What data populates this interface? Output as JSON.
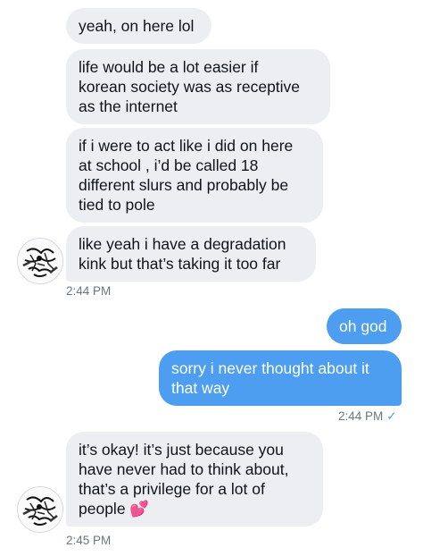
{
  "thread": {
    "incoming_group_1": [
      "yeah, on here lol",
      "life would be a lot easier if\nkorean society was as receptive\nas the internet",
      "if i were to act like i did on here\nat school , i’d be called 18\ndifferent slurs and probably be\ntied to pole",
      "like yeah i have a degradation\nkink but that’s taking it too far"
    ],
    "timestamp_1": "2:44 PM",
    "outgoing": [
      "oh god",
      "sorry i never thought about it\nthat way"
    ],
    "timestamp_2": "2:44 PM",
    "read_check": "✓",
    "incoming_group_2": [
      "it’s okay! it’s just because you\nhave never had to think about,\nthat’s a privilege for a lot of\npeople 💕"
    ],
    "timestamp_3": "2:45 PM"
  },
  "colors": {
    "incoming_bubble": "#eceef2",
    "outgoing_bubble": "#4d9ef0",
    "timestamp": "#6b7680"
  },
  "icons": {
    "avatar": "sketch-avatar"
  }
}
